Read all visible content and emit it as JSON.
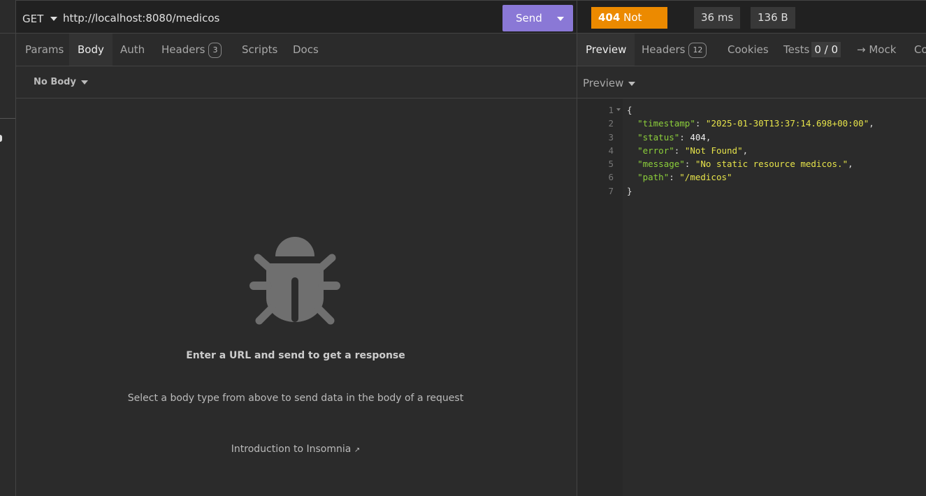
{
  "request": {
    "method": "GET",
    "url": "http://localhost:8080/medicos",
    "send_label": "Send",
    "tabs": [
      {
        "label": "Params"
      },
      {
        "label": "Body",
        "active": true
      },
      {
        "label": "Auth"
      },
      {
        "label": "Headers",
        "count": "3"
      },
      {
        "label": "Scripts"
      },
      {
        "label": "Docs"
      }
    ],
    "body_type": "No Body",
    "empty_state": {
      "icon": "bug-icon",
      "title": "Enter a URL and send to get a response",
      "description": "Select a body type from above to send data in the body of a request",
      "link": "Introduction to Insomnia"
    }
  },
  "response": {
    "status_code": "404",
    "status_text": "Not Found",
    "time": "36 ms",
    "size": "136 B",
    "status_color": "#ec8a00",
    "tabs": [
      {
        "label": "Preview",
        "active": true
      },
      {
        "label": "Headers",
        "count": "12"
      },
      {
        "label": "Cookies"
      },
      {
        "label": "Tests",
        "count": "0 / 0"
      },
      {
        "label": "→ Mock"
      },
      {
        "label": "Co"
      }
    ],
    "preview_mode": "Preview",
    "body_lines": [
      {
        "n": "1",
        "text": "{"
      },
      {
        "n": "2",
        "key": "\"timestamp\"",
        "value": "\"2025-01-30T13:37:14.698+00:00\"",
        "type": "string",
        "comma": ","
      },
      {
        "n": "3",
        "key": "\"status\"",
        "value": "404",
        "type": "number",
        "comma": ","
      },
      {
        "n": "4",
        "key": "\"error\"",
        "value": "\"Not Found\"",
        "type": "string",
        "comma": ","
      },
      {
        "n": "5",
        "key": "\"message\"",
        "value": "\"No static resource medicos.\"",
        "type": "string",
        "comma": ","
      },
      {
        "n": "6",
        "key": "\"path\"",
        "value": "\"/medicos\"",
        "type": "string",
        "comma": ""
      },
      {
        "n": "7",
        "text": "}"
      }
    ]
  },
  "colors": {
    "send": "#8a78d6",
    "json_key": "#8ccf3b",
    "json_string": "#e6e34a",
    "background": "#2b2b2b"
  }
}
